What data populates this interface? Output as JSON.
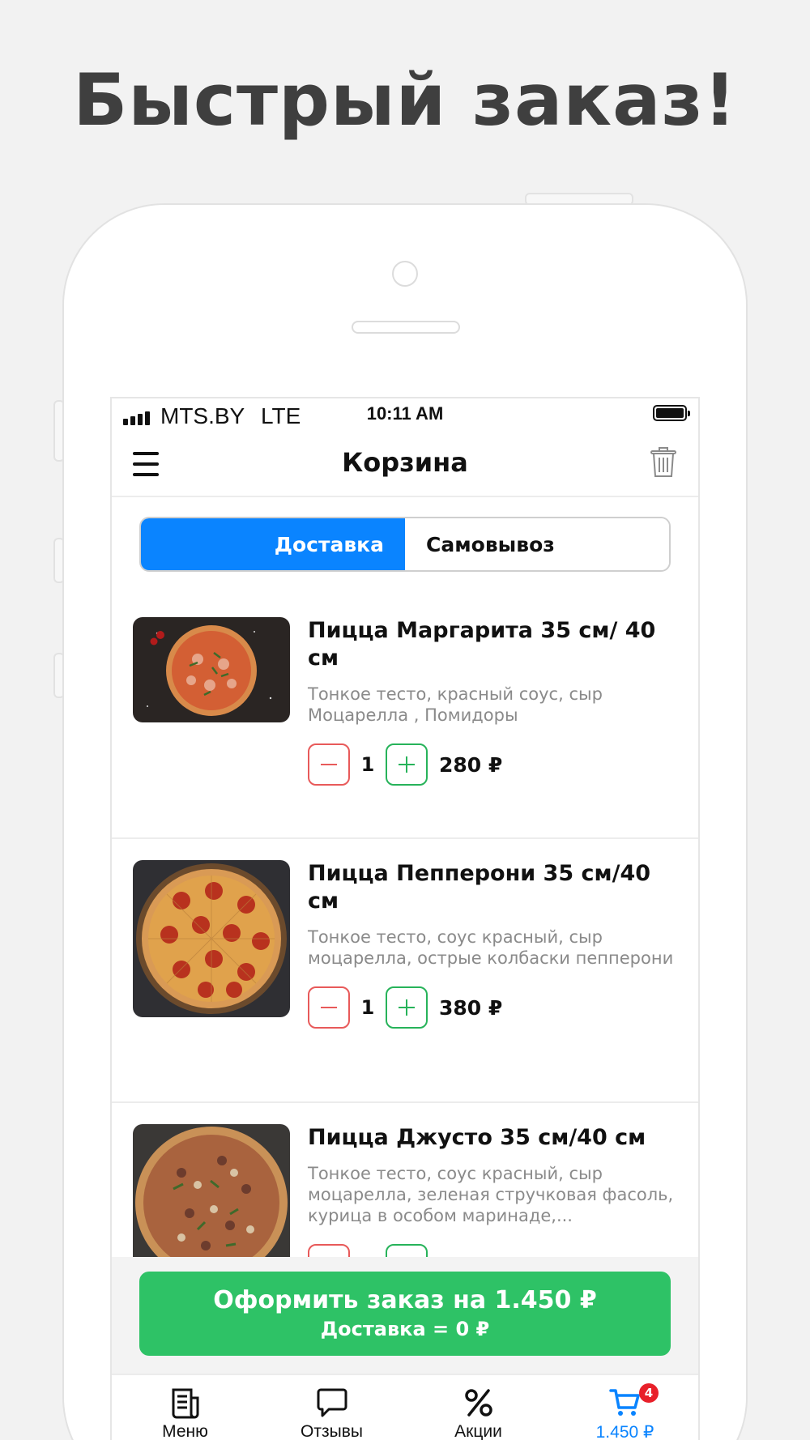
{
  "headline": "Быстрый заказ!",
  "status_bar": {
    "carrier": "MTS.BY",
    "network": "LTE",
    "time": "10:11 AM"
  },
  "header": {
    "title": "Корзина"
  },
  "segment": {
    "delivery": "Доставка",
    "pickup": "Самовывоз",
    "selected": "delivery"
  },
  "items": [
    {
      "name": "Пицца Маргарита 35 см/ 40 см",
      "description": "Тонкое тесто, красный соус, сыр Моцарелла , Помидоры",
      "qty": "1",
      "price": "280 ₽"
    },
    {
      "name": "Пицца Пепперони 35 см/40 см",
      "description": "Тонкое тесто, соус красный, сыр моцарелла, острые колбаски пепперони",
      "qty": "1",
      "price": "380 ₽"
    },
    {
      "name": "Пицца Джусто 35 см/40 см",
      "description": "Тонкое тесто, соус красный, сыр моцарелла, зеленая стручковая фасоль, курица в особом маринаде,..."
    }
  ],
  "checkout": {
    "line1": "Оформить заказ на 1.450 ₽",
    "line2": "Доставка = 0 ₽"
  },
  "tabbar": [
    {
      "label": "Меню",
      "icon": "menu-document-icon"
    },
    {
      "label": "Отзывы",
      "icon": "chat-bubble-icon"
    },
    {
      "label": "Акции",
      "icon": "percent-icon"
    },
    {
      "label": "1.450 ₽",
      "icon": "cart-icon",
      "badge": "4",
      "active": true
    }
  ],
  "colors": {
    "accent_blue": "#0a84ff",
    "green": "#2ec266",
    "minus_red": "#e85a5a",
    "plus_green": "#27b35a",
    "badge_red": "#e8202a"
  }
}
